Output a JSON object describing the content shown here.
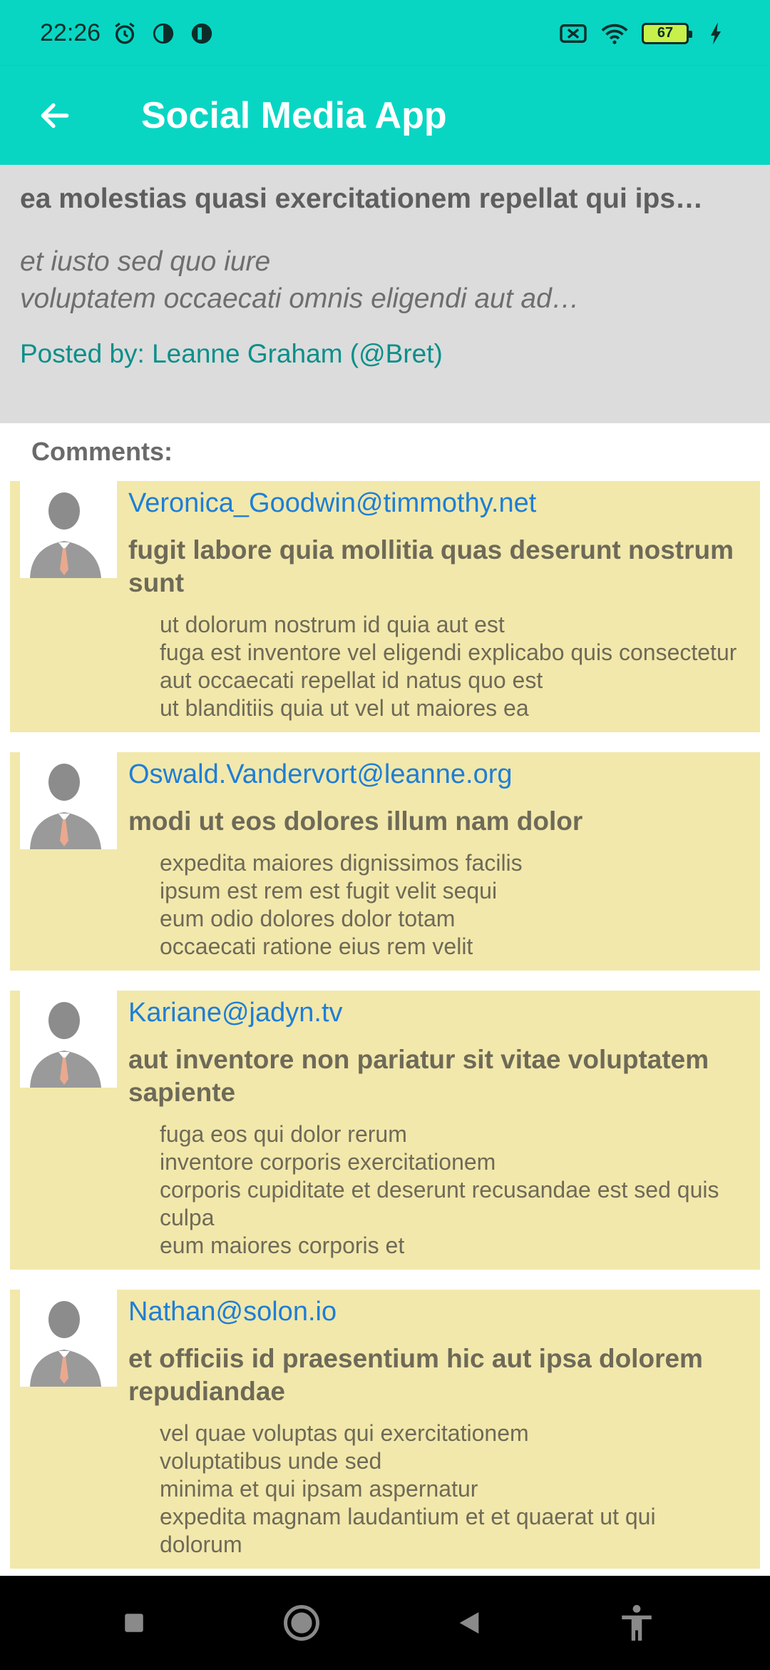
{
  "status_bar": {
    "time": "22:26",
    "battery_level": "67",
    "icons": [
      "alarm-icon",
      "app-notification-icon",
      "app-notification-icon",
      "no-sim-icon",
      "wifi-icon",
      "battery-icon",
      "charging-icon"
    ]
  },
  "app_bar": {
    "title": "Social Media App",
    "back_icon": "arrow-left-icon"
  },
  "post": {
    "title": "ea molestias quasi exercitationem repellat qui ips…",
    "body_line1": "et iusto sed quo iure",
    "body_line2": "voluptatem occaecati omnis eligendi aut ad…",
    "author": "Posted by: Leanne Graham (@Bret)"
  },
  "comments_label": "Comments:",
  "comments": [
    {
      "email": "Veronica_Goodwin@timmothy.net",
      "name": "fugit labore quia mollitia quas deserunt nostrum sunt",
      "lines": [
        "ut dolorum nostrum id quia aut est",
        "fuga est inventore vel eligendi explicabo quis consectetur",
        "aut occaecati repellat id natus quo est",
        "ut blanditiis quia ut vel ut maiores ea"
      ]
    },
    {
      "email": "Oswald.Vandervort@leanne.org",
      "name": "modi ut eos dolores illum nam dolor",
      "lines": [
        "expedita maiores dignissimos facilis",
        "ipsum est rem est fugit velit sequi",
        "eum odio dolores dolor totam",
        "occaecati ratione eius rem velit"
      ]
    },
    {
      "email": "Kariane@jadyn.tv",
      "name": "aut inventore non pariatur sit vitae voluptatem sapiente",
      "lines": [
        "fuga eos qui dolor rerum",
        "inventore corporis exercitationem",
        "corporis cupiditate et deserunt recusandae est sed quis culpa",
        "eum maiores corporis et"
      ]
    },
    {
      "email": "Nathan@solon.io",
      "name": "et officiis id praesentium hic aut ipsa dolorem repudiandae",
      "lines": [
        "vel quae voluptas qui exercitationem",
        "voluptatibus unde sed",
        "minima et qui ipsam aspernatur",
        "expedita magnam laudantium et et quaerat ut qui dolorum"
      ]
    }
  ],
  "nav_bar": {
    "icons": [
      "recents-square-icon",
      "home-circle-icon",
      "back-triangle-icon",
      "accessibility-icon"
    ]
  },
  "colors": {
    "accent": "#08d6c3",
    "post_background": "#dcdcdc",
    "comment_background": "#f2e8ab",
    "email_link": "#1e7ed6",
    "author_text": "#0a8f8a"
  }
}
